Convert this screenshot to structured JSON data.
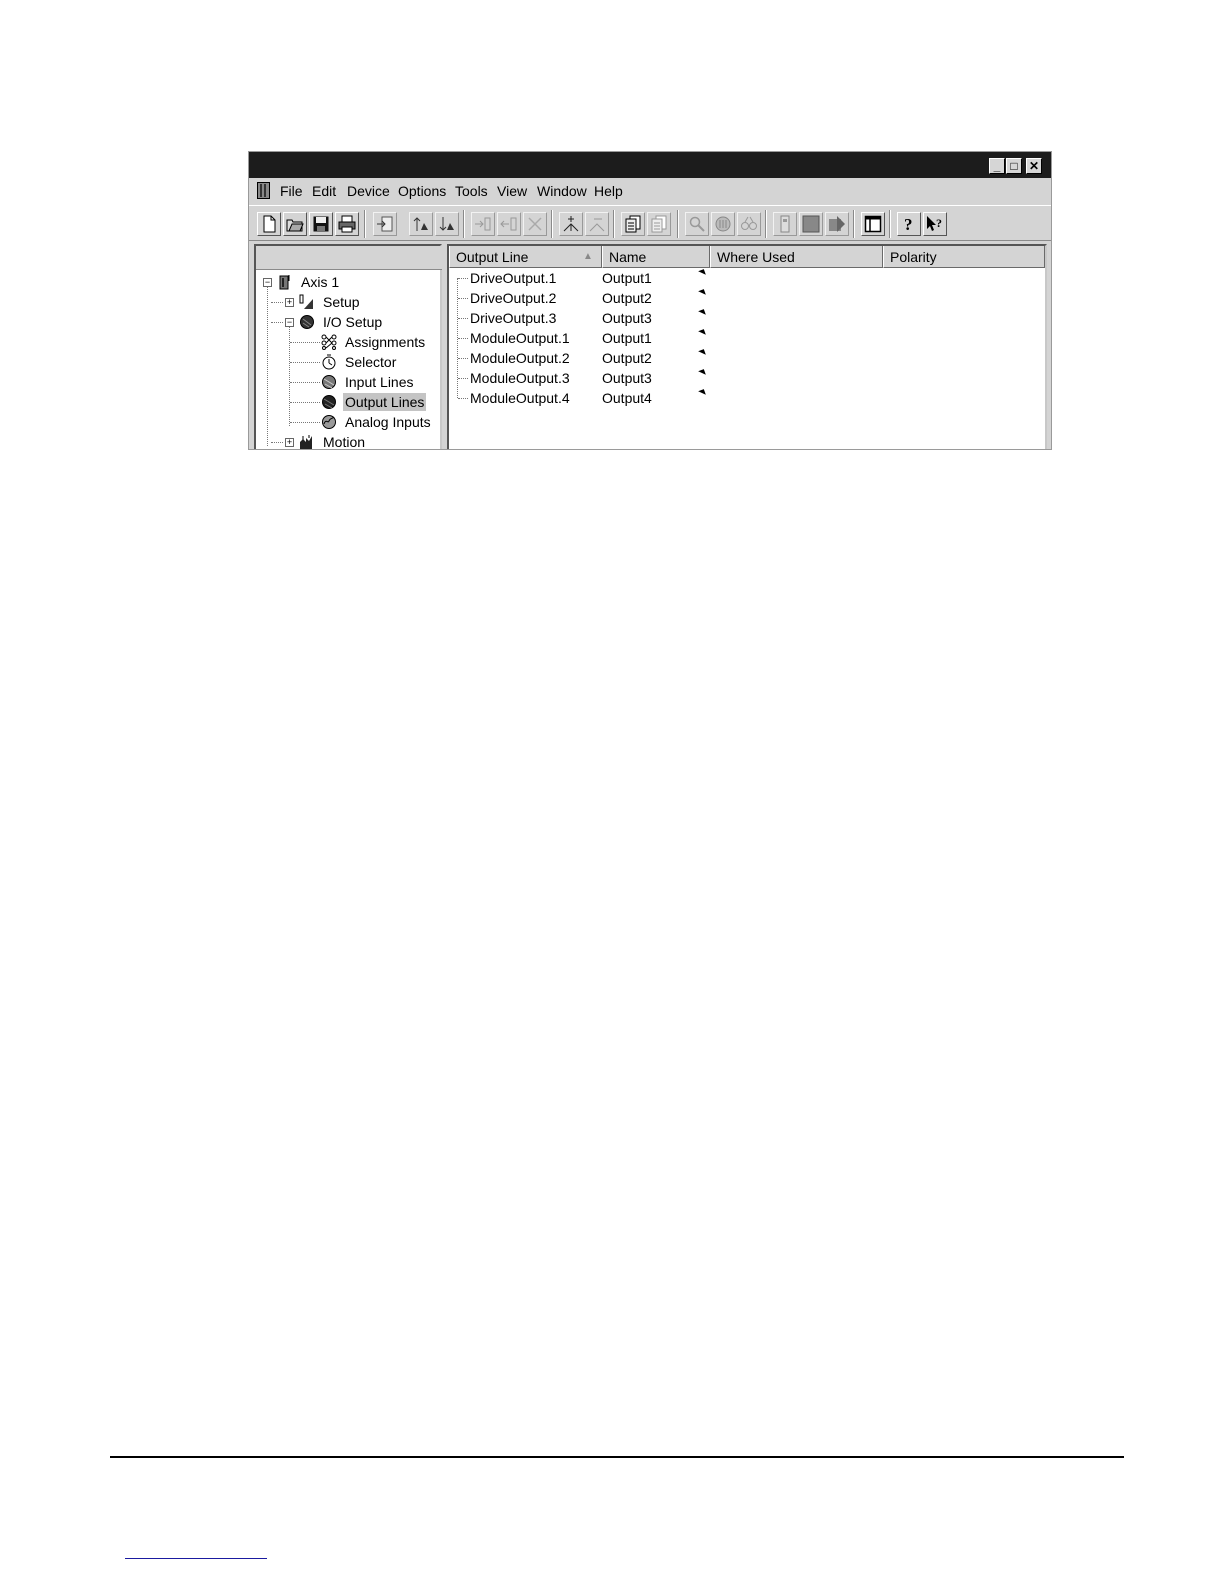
{
  "window": {
    "caption_buttons": [
      "minimize",
      "maximize",
      "close"
    ],
    "mdi_buttons": [
      "minimize",
      "restore",
      "close"
    ]
  },
  "menu": {
    "items": [
      "File",
      "Edit",
      "Device",
      "Options",
      "Tools",
      "View",
      "Window",
      "Help"
    ]
  },
  "toolbar": {
    "buttons": [
      "new-icon",
      "open-icon",
      "save-icon",
      "print-icon",
      "upload-icon",
      "move-up-icon",
      "move-down-icon",
      "insert-right-icon",
      "insert-left-icon",
      "delete-icon",
      "add-node-icon",
      "remove-node-icon",
      "copy-icon",
      "paste-icon",
      "zoom-icon",
      "monitor-icon",
      "oscilloscope-icon",
      "device-icon",
      "stop-icon",
      "run-icon",
      "layout-icon",
      "help-icon",
      "context-help-icon"
    ]
  },
  "tree": {
    "nodes": [
      {
        "label": "Axis 1",
        "expander": "−",
        "icon": "drive-icon",
        "level": 0
      },
      {
        "label": "Setup",
        "expander": "+",
        "icon": "setup-icon",
        "level": 1
      },
      {
        "label": "I/O Setup",
        "expander": "−",
        "icon": "io-setup-icon",
        "level": 1
      },
      {
        "label": "Assignments",
        "expander": "",
        "icon": "assignments-icon",
        "level": 2
      },
      {
        "label": "Selector",
        "expander": "",
        "icon": "selector-icon",
        "level": 2
      },
      {
        "label": "Input Lines",
        "expander": "",
        "icon": "input-lines-icon",
        "level": 2
      },
      {
        "label": "Output Lines",
        "expander": "",
        "icon": "output-lines-icon",
        "level": 2,
        "selected": true
      },
      {
        "label": "Analog Inputs",
        "expander": "",
        "icon": "analog-inputs-icon",
        "level": 2
      },
      {
        "label": "Motion",
        "expander": "+",
        "icon": "motion-icon",
        "level": 1
      }
    ]
  },
  "list": {
    "columns": [
      "Output Line",
      "Name",
      "Where Used",
      "Polarity"
    ],
    "sort_column": "Output Line",
    "rows": [
      {
        "output_line": "DriveOutput.1",
        "name": "Output1"
      },
      {
        "output_line": "DriveOutput.2",
        "name": "Output2"
      },
      {
        "output_line": "DriveOutput.3",
        "name": "Output3"
      },
      {
        "output_line": "ModuleOutput.1",
        "name": "Output1"
      },
      {
        "output_line": "ModuleOutput.2",
        "name": "Output2"
      },
      {
        "output_line": "ModuleOutput.3",
        "name": "Output3"
      },
      {
        "output_line": "ModuleOutput.4",
        "name": "Output4"
      }
    ]
  },
  "colors": {
    "title_bar": "#1c1c1c",
    "chrome": "#d4d4d4",
    "selection": "#c4c4c4"
  }
}
